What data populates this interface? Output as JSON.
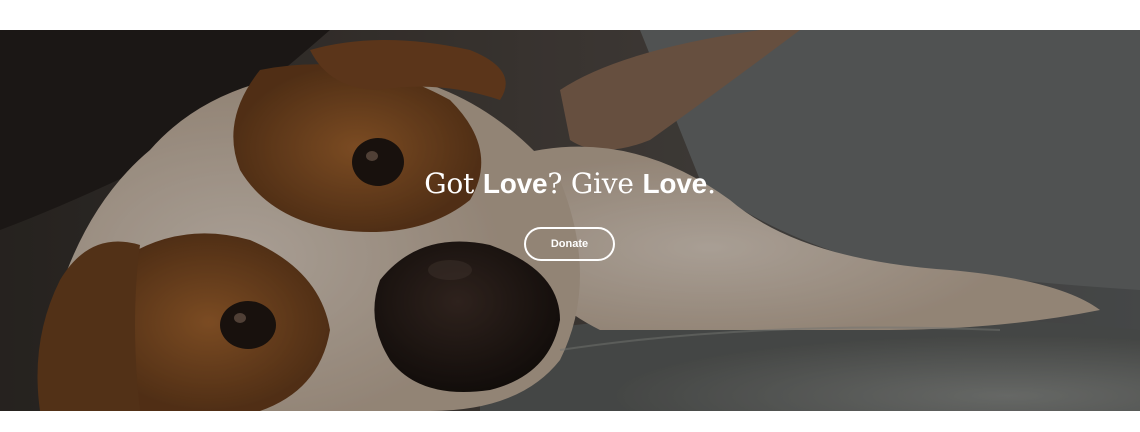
{
  "hero": {
    "headline": {
      "part1": "Got ",
      "bold1": "Love",
      "part2": "? Give ",
      "bold2": "Love",
      "part3": "."
    },
    "donate_label": "Donate",
    "background_image": "dog-lying-on-couch-photo"
  },
  "colors": {
    "text": "#ffffff",
    "page_background": "#ffffff"
  }
}
